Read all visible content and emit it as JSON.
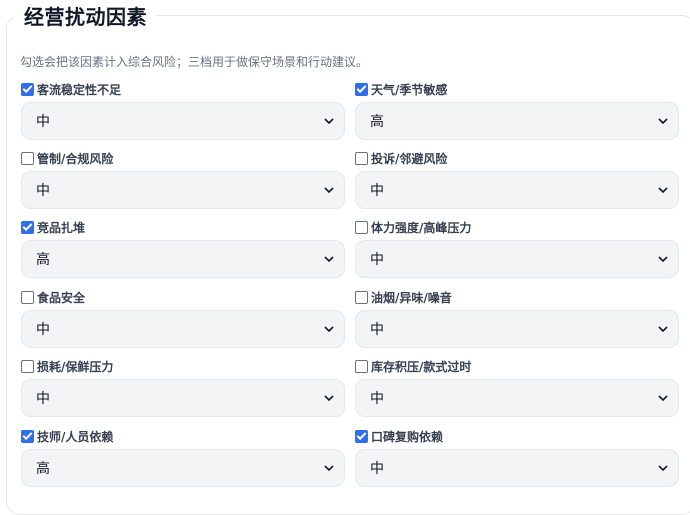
{
  "section": {
    "title": "经营扰动因素",
    "hint": "勾选会把该因素计入综合风险；三档用于做保守场景和行动建议。"
  },
  "factors": [
    {
      "label": "客流稳定性不足",
      "checked": true,
      "level": "中"
    },
    {
      "label": "天气/季节敏感",
      "checked": true,
      "level": "高"
    },
    {
      "label": "管制/合规风险",
      "checked": false,
      "level": "中"
    },
    {
      "label": "投诉/邻避风险",
      "checked": false,
      "level": "中"
    },
    {
      "label": "竞品扎堆",
      "checked": true,
      "level": "高"
    },
    {
      "label": "体力强度/高峰压力",
      "checked": false,
      "level": "中"
    },
    {
      "label": "食品安全",
      "checked": false,
      "level": "中"
    },
    {
      "label": "油烟/异味/噪音",
      "checked": false,
      "level": "中"
    },
    {
      "label": "损耗/保鲜压力",
      "checked": false,
      "level": "中"
    },
    {
      "label": "库存积压/款式过时",
      "checked": false,
      "level": "中"
    },
    {
      "label": "技师/人员依赖",
      "checked": true,
      "level": "高"
    },
    {
      "label": "口碑复购依赖",
      "checked": true,
      "level": "中"
    }
  ],
  "icons": {
    "checkbox": "checkbox-icon",
    "dropdown": "chevron-down-icon"
  },
  "colors": {
    "accent": "#2f6fed",
    "select_bg": "#f3f4f6"
  }
}
